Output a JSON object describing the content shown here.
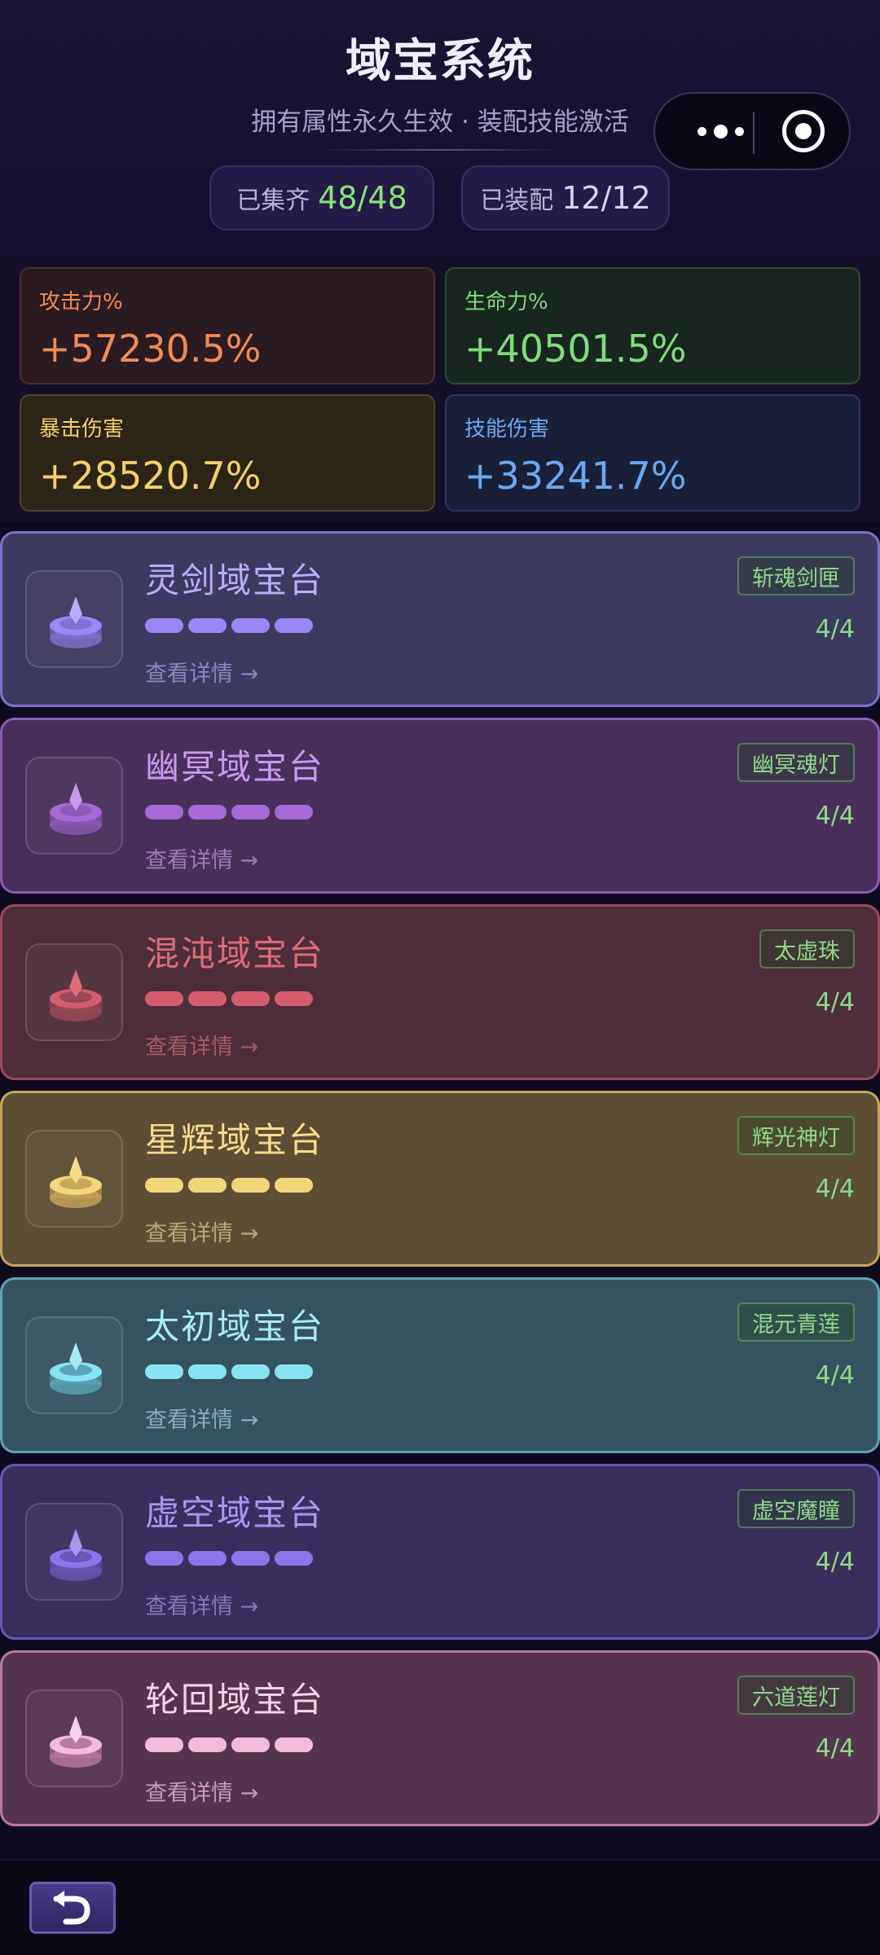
{
  "header": {
    "title": "域宝系统",
    "subtitle": "拥有属性永久生效 · 装配技能激活",
    "collected_label": "已集齐",
    "collected_value": "48/48",
    "equipped_label": "已装配",
    "equipped_value": "12/12"
  },
  "stats": {
    "attack": {
      "label": "攻击力%",
      "value": "+57230.5%"
    },
    "hp": {
      "label": "生命力%",
      "value": "+40501.5%"
    },
    "crit": {
      "label": "暴击伤害",
      "value": "+28520.7%"
    },
    "skill": {
      "label": "技能伤害",
      "value": "+33241.7%"
    }
  },
  "cards": [
    {
      "title": "灵剑域宝台",
      "tag": "斩魂剑匣",
      "count": "4/4",
      "details": "查看详情 →",
      "progress": 1.0,
      "colors": {
        "bg": "#3d3a5f",
        "border": "#7f72cf",
        "title": "#b8adff",
        "bar": "#9a86f5",
        "details": "#8d84bd"
      }
    },
    {
      "title": "幽冥域宝台",
      "tag": "幽冥魂灯",
      "count": "4/4",
      "details": "查看详情 →",
      "progress": 1.0,
      "colors": {
        "bg": "#47305a",
        "border": "#8c5cb8",
        "title": "#c79af0",
        "bar": "#a56ad6",
        "details": "#9a7cb6"
      }
    },
    {
      "title": "混沌域宝台",
      "tag": "太虚珠",
      "count": "4/4",
      "details": "查看详情 →",
      "progress": 1.0,
      "colors": {
        "bg": "#4e2e3a",
        "border": "#9c4858",
        "title": "#e06a78",
        "bar": "#d45c6c",
        "details": "#a35c66"
      }
    },
    {
      "title": "星辉域宝台",
      "tag": "辉光神灯",
      "count": "4/4",
      "details": "查看详情 →",
      "progress": 1.0,
      "colors": {
        "bg": "#5c4e35",
        "border": "#c7a85a",
        "title": "#f7dc8c",
        "bar": "#f2d67a",
        "details": "#bda676"
      }
    },
    {
      "title": "太初域宝台",
      "tag": "混元青莲",
      "count": "4/4",
      "details": "查看详情 →",
      "progress": 1.0,
      "colors": {
        "bg": "#35535f",
        "border": "#5aa6b4",
        "title": "#a6ecf5",
        "bar": "#8ae3f2",
        "details": "#84b0ba"
      }
    },
    {
      "title": "虚空域宝台",
      "tag": "虚空魔瞳",
      "count": "4/4",
      "details": "查看详情 →",
      "progress": 1.0,
      "colors": {
        "bg": "#3a2f5c",
        "border": "#6a55b8",
        "title": "#a896f2",
        "bar": "#8c74ea",
        "details": "#8677b8"
      }
    },
    {
      "title": "轮回域宝台",
      "tag": "六道莲灯",
      "count": "4/4",
      "details": "查看详情 →",
      "progress": 1.0,
      "colors": {
        "bg": "#55344d",
        "border": "#b97aa2",
        "title": "#f5d2e8",
        "bar": "#f2bcd8",
        "details": "#c89ab6"
      }
    }
  ]
}
